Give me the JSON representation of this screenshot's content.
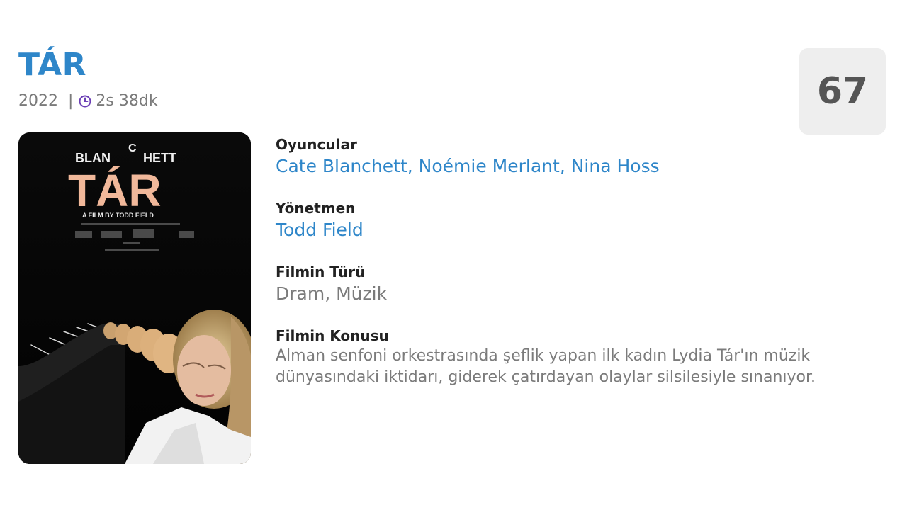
{
  "movie": {
    "title": "TÁR",
    "year": "2022",
    "separator": "|",
    "duration": "2s 38dk",
    "duration_icon": "clock-icon",
    "score": "67",
    "poster": {
      "name_part1": "BLAN",
      "name_letter": "C",
      "name_part2": "HETT",
      "title": "TÁR",
      "byline": "A FILM BY TODD FIELD"
    }
  },
  "fields": {
    "cast_label": "Oyuncular",
    "cast": [
      "Cate Blanchett",
      "Noémie Merlant",
      "Nina Hoss"
    ],
    "cast_separator": ", ",
    "director_label": "Yönetmen",
    "director": "Todd Field",
    "genre_label": "Filmin Türü",
    "genre": "Dram, Müzik",
    "plot_label": "Filmin Konusu",
    "plot": "Alman senfoni orkestrasında şeflik yapan ilk kadın Lydia Tár'ın müzik dünyasındaki iktidarı, giderek çatırdayan olaylar silsilesiyle sınanıyor."
  },
  "colors": {
    "accent": "#2e86c9",
    "muted_text": "#7b7b7b",
    "label_text": "#222222",
    "score_bg": "#eeeeee",
    "clock_icon": "#6b3fb5",
    "poster_title": "#f1b89a"
  }
}
